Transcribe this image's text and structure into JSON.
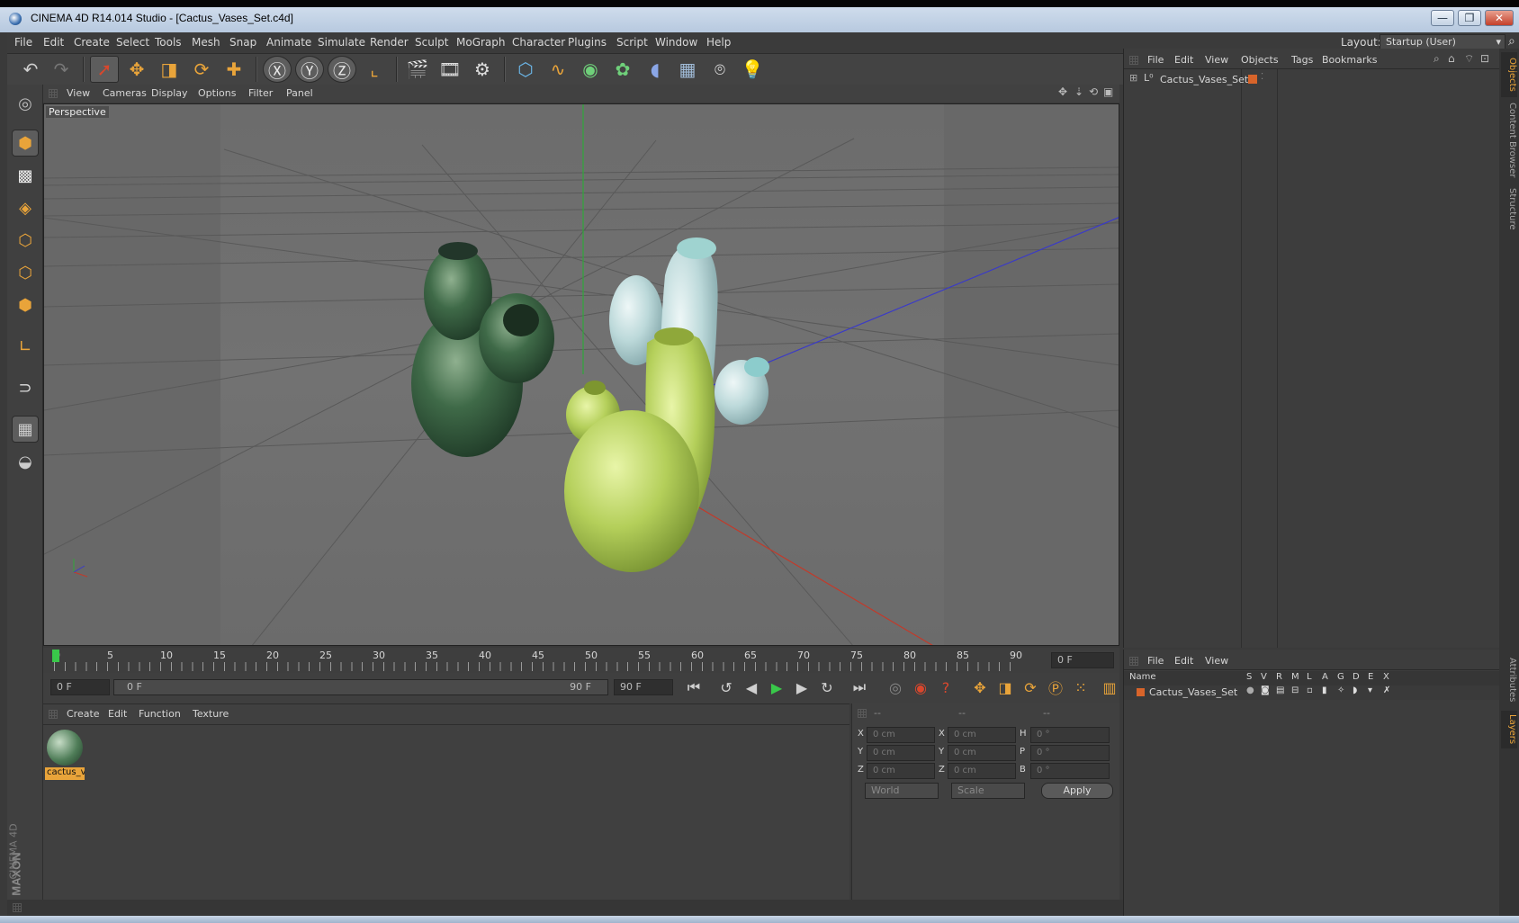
{
  "window": {
    "title": "CINEMA 4D R14.014 Studio - [Cactus_Vases_Set.c4d]",
    "minimize": "—",
    "restore": "❐",
    "close": "✕"
  },
  "menu": [
    "File",
    "Edit",
    "Create",
    "Select",
    "Tools",
    "Mesh",
    "Snap",
    "Animate",
    "Simulate",
    "Render",
    "Sculpt",
    "MoGraph",
    "Character",
    "Plugins",
    "Script",
    "Window",
    "Help"
  ],
  "layout": {
    "label": "Layout:",
    "value": "Startup (User)"
  },
  "viewport": {
    "menu": [
      "View",
      "Cameras",
      "Display",
      "Options",
      "Filter",
      "Panel"
    ],
    "label": "Perspective"
  },
  "timeline": {
    "ticks": [
      "0",
      "5",
      "10",
      "15",
      "20",
      "25",
      "30",
      "35",
      "40",
      "45",
      "50",
      "55",
      "60",
      "65",
      "70",
      "75",
      "80",
      "85",
      "90"
    ],
    "frame_readout": "0 F"
  },
  "transport": {
    "start_frame": "0 F",
    "range_start": "0 F",
    "range_end": "90 F",
    "end_frame": "90 F"
  },
  "material": {
    "menu": [
      "Create",
      "Edit",
      "Function",
      "Texture"
    ],
    "items": [
      {
        "name": "cactus_v"
      }
    ]
  },
  "coords": {
    "headers": [
      "--",
      "--",
      "--"
    ],
    "rows": [
      {
        "a": "X",
        "av": "0 cm",
        "b": "X",
        "bv": "0 cm",
        "c": "H",
        "cv": "0 °"
      },
      {
        "a": "Y",
        "av": "0 cm",
        "b": "Y",
        "bv": "0 cm",
        "c": "P",
        "cv": "0 °"
      },
      {
        "a": "Z",
        "av": "0 cm",
        "b": "Z",
        "bv": "0 cm",
        "c": "B",
        "cv": "0 °"
      }
    ],
    "space": "World",
    "mode": "Scale",
    "apply": "Apply"
  },
  "objects": {
    "menu": [
      "File",
      "Edit",
      "View",
      "Objects",
      "Tags",
      "Bookmarks"
    ],
    "items": [
      {
        "name": "Cactus_Vases_Set"
      }
    ]
  },
  "layers": {
    "menu": [
      "File",
      "Edit",
      "View"
    ],
    "columns": [
      "Name",
      "S",
      "V",
      "R",
      "M",
      "L",
      "A",
      "G",
      "D",
      "E",
      "X"
    ],
    "items": [
      {
        "name": "Cactus_Vases_Set"
      }
    ]
  },
  "side_tabs": [
    "Objects",
    "Content Browser",
    "Structure",
    "Attributes",
    "Layers"
  ],
  "brand": {
    "maxon": "MAXON",
    "product": "CINEMA 4D"
  },
  "colors": {
    "accent": "#e9a43a",
    "layer": "#d8642a"
  }
}
